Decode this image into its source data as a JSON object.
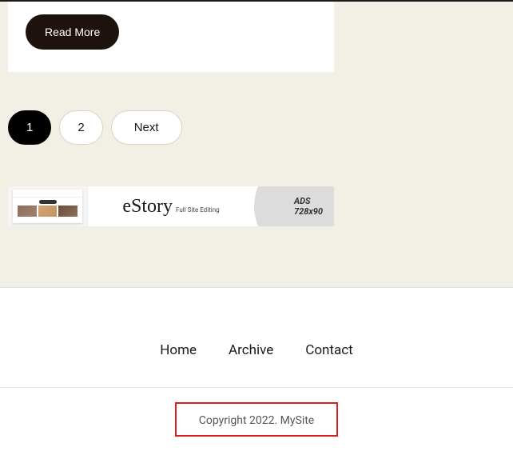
{
  "card": {
    "read_more_label": "Read More"
  },
  "pagination": {
    "page1": "1",
    "page2": "2",
    "next": "Next"
  },
  "ad": {
    "title": "eStory",
    "subtitle": "Full Site Editing",
    "label": "ADS",
    "size": "728x90"
  },
  "footer": {
    "links": {
      "home": "Home",
      "archive": "Archive",
      "contact": "Contact"
    },
    "copyright": "Copyright 2022. MySite"
  }
}
